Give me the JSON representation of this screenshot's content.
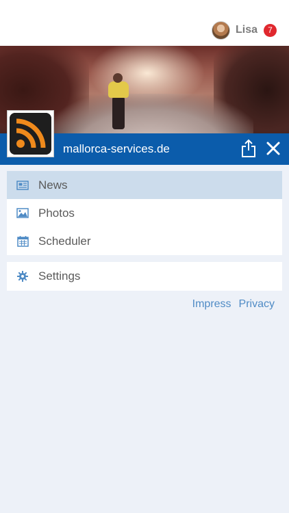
{
  "user": {
    "name": "Lisa",
    "notification_count": "7"
  },
  "site": {
    "title": "mallorca-services.de"
  },
  "menu": [
    {
      "label": "News",
      "icon": "newspaper-icon",
      "active": true
    },
    {
      "label": "Photos",
      "icon": "image-icon",
      "active": false
    },
    {
      "label": "Scheduler",
      "icon": "calendar-icon",
      "active": false
    }
  ],
  "settings": {
    "label": "Settings",
    "icon": "gear-icon"
  },
  "footer_links": {
    "impress": "Impress",
    "privacy": "Privacy"
  },
  "colors": {
    "header_bar": "#0b5cab",
    "active_item": "#ccdcec",
    "link": "#4f8bc5",
    "badge": "#e0282e",
    "background": "#edf1f8"
  }
}
